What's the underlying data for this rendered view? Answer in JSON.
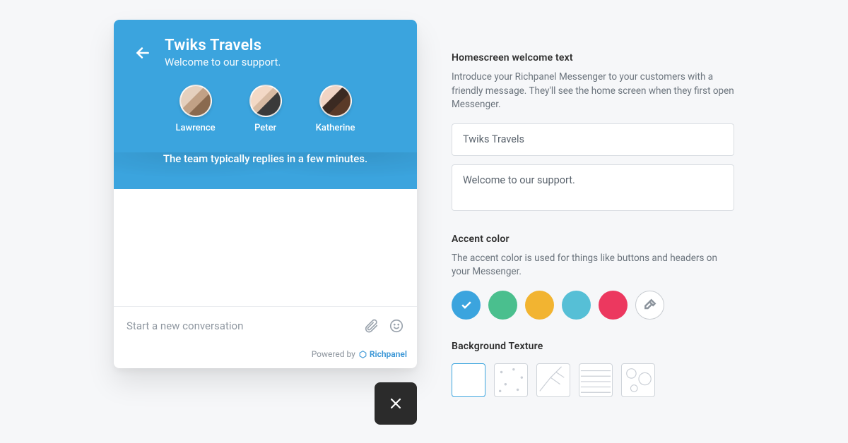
{
  "messenger": {
    "title": "Twiks Travels",
    "subtitle": "Welcome to our support.",
    "reply_line": "The team typically replies in a few minutes.",
    "agents": [
      {
        "name": "Lawrence"
      },
      {
        "name": "Peter"
      },
      {
        "name": "Katherine"
      }
    ],
    "compose_placeholder": "Start a new conversation",
    "footer_label": "Powered by",
    "brand": "Richpanel"
  },
  "settings": {
    "welcome": {
      "title": "Homescreen welcome text",
      "desc": "Introduce your Richpanel Messenger to your customers with a friendly message. They'll see the home screen when they first open Messenger.",
      "field_title": "Twiks Travels",
      "field_body": "Welcome to our support."
    },
    "accent": {
      "title": "Accent color",
      "desc": "The accent color is used for things like buttons and headers on your Messenger.",
      "colors": [
        "#3ba4de",
        "#4abf8e",
        "#f2b431",
        "#56bfd6",
        "#ec385f"
      ],
      "selected_index": 0
    },
    "texture": {
      "title": "Background Texture",
      "selected_index": 0
    }
  }
}
